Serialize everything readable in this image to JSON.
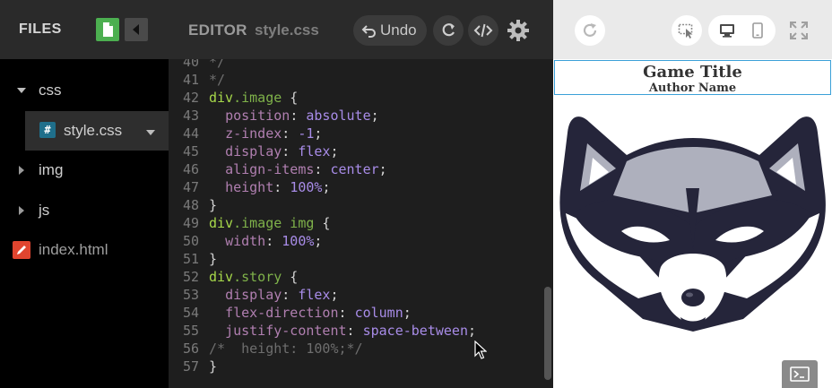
{
  "files_pane": {
    "title": "FILES",
    "tree": [
      {
        "name": "css",
        "type": "folder",
        "state": "expanded"
      },
      {
        "name": "style.css",
        "type": "css-file",
        "selected": true
      },
      {
        "name": "img",
        "type": "folder",
        "state": "collapsed"
      },
      {
        "name": "js",
        "type": "folder",
        "state": "collapsed"
      },
      {
        "name": "index.html",
        "type": "html-file"
      }
    ],
    "css_badge": "#"
  },
  "editor": {
    "title": "EDITOR",
    "filename": "style.css",
    "undo_label": "Undo",
    "lines": [
      {
        "n": "40",
        "code": "*/"
      },
      {
        "n": "41",
        "code": "*/"
      },
      {
        "n": "42",
        "code": "div.image {"
      },
      {
        "n": "43",
        "code": "  position: absolute;"
      },
      {
        "n": "44",
        "code": "  z-index: -1;"
      },
      {
        "n": "45",
        "code": "  display: flex;"
      },
      {
        "n": "46",
        "code": "  align-items: center;"
      },
      {
        "n": "47",
        "code": "  height: 100%;"
      },
      {
        "n": "48",
        "code": "}"
      },
      {
        "n": "49",
        "code": "div.image img {"
      },
      {
        "n": "50",
        "code": "  width: 100%;"
      },
      {
        "n": "51",
        "code": "}"
      },
      {
        "n": "52",
        "code": "div.story {"
      },
      {
        "n": "53",
        "code": "  display: flex;"
      },
      {
        "n": "54",
        "code": "  flex-direction: column;"
      },
      {
        "n": "55",
        "code": "  justify-content: space-between;"
      },
      {
        "n": "56",
        "code": "/*  height: 100%;*/"
      },
      {
        "n": "57",
        "code": "}"
      }
    ]
  },
  "preview": {
    "game_title": "Game Title",
    "author_name": "Author Name"
  },
  "colors": {
    "new_file_green": "#4caf50",
    "html_icon_red": "#e0452f",
    "css_icon_blue": "#1f6f8b",
    "preview_outline_blue": "#3ba0d8",
    "raccoon_dark": "#25253a",
    "raccoon_gray": "#aeb0bd"
  }
}
